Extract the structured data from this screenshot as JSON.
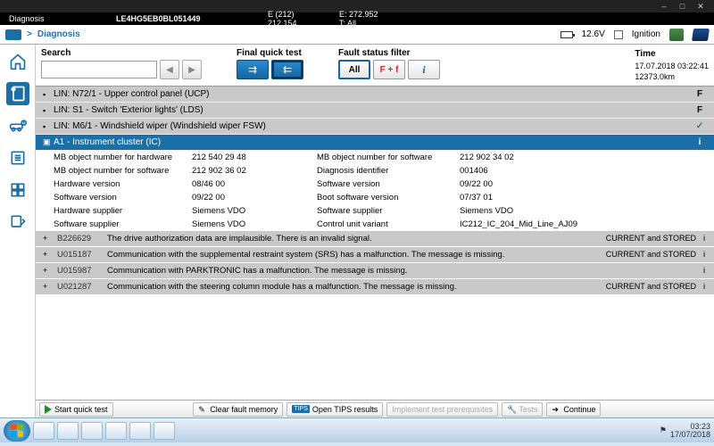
{
  "titlebar": {
    "app": "",
    "title": ""
  },
  "header": {
    "section": "Diagnosis",
    "vin": "LE4HG5EB0BL051449",
    "col2a": "E (212)",
    "col2b": "212.154",
    "col3a": "E: 272.952",
    "col3b": "T: All"
  },
  "breadcrumb": {
    "arrow": ">",
    "current": "Diagnosis",
    "voltage": "12.6V",
    "ignition_label": "Ignition"
  },
  "toolbar": {
    "search_label": "Search",
    "search_value": "",
    "quicktest_label": "Final quick test",
    "filter_label": "Fault status filter",
    "filter_all": "All",
    "filter_ff": "F + f",
    "filter_i": "i",
    "time_label": "Time",
    "time_value": "17.07.2018 03:22:41",
    "distance": "12373.0km"
  },
  "ecu_rows": [
    {
      "label": "LIN: N72/1 - Upper control panel (UCP)",
      "status": "F"
    },
    {
      "label": "LIN: S1 - Switch 'Exterior lights' (LDS)",
      "status": "F"
    },
    {
      "label": "LIN: M6/1 - Windshield wiper (Windshield wiper FSW)",
      "status": "✓"
    }
  ],
  "expanded": {
    "label": "A1 - Instrument cluster (IC)",
    "status": "i"
  },
  "details": [
    [
      "MB object number for hardware",
      "212 540 29 48",
      "MB object number for software",
      "212 902 34 02"
    ],
    [
      "MB object number for software",
      "212 902 36 02",
      "Diagnosis identifier",
      "001406"
    ],
    [
      "Hardware version",
      "08/46 00",
      "Software version",
      "09/22 00"
    ],
    [
      "Software version",
      "09/22 00",
      "Boot software version",
      "07/37 01"
    ],
    [
      "Hardware supplier",
      "Siemens VDO",
      "Software supplier",
      "Siemens VDO"
    ],
    [
      "Software supplier",
      "Siemens VDO",
      "Control unit variant",
      "IC212_IC_204_Mid_Line_AJ09"
    ]
  ],
  "faults": [
    {
      "code": "B226629",
      "msg": "The drive authorization data are implausible. There is an invalid signal.",
      "st": "CURRENT and STORED"
    },
    {
      "code": "U015187",
      "msg": "Communication with the supplemental restraint system (SRS) has a malfunction. The message is missing.",
      "st": "CURRENT and STORED"
    },
    {
      "code": "U015987",
      "msg": "Communication with PARKTRONIC has a malfunction. The message is missing.",
      "st": ""
    },
    {
      "code": "U021287",
      "msg": "Communication with the steering column module has a malfunction. The message is missing.",
      "st": "CURRENT and STORED"
    }
  ],
  "bottom": {
    "start": "Start quick test",
    "clear": "Clear fault memory",
    "tips": "Open TIPS results",
    "prereq": "Implement test prerequisites",
    "tests": "Tests",
    "continue": "Continue"
  },
  "tray": {
    "time": "03:23",
    "date": "17/07/2018"
  }
}
